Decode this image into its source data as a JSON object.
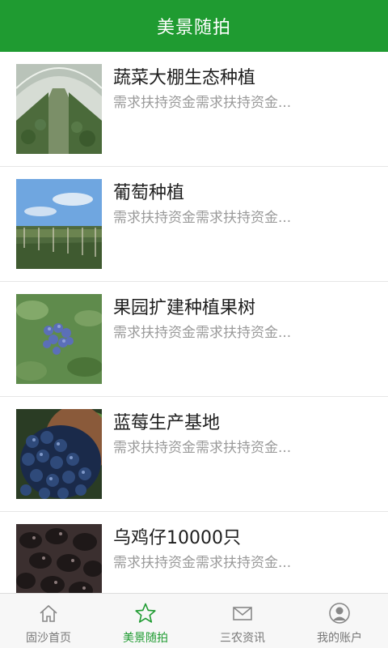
{
  "header": {
    "title": "美景随拍"
  },
  "colors": {
    "accent": "#1f9b31",
    "text": "#1e1e1e",
    "muted": "#9a9a9a"
  },
  "items": [
    {
      "title": "蔬菜大棚生态种植",
      "desc": "需求扶持资金需求扶持资金...",
      "image": "greenhouse-photo"
    },
    {
      "title": "葡萄种植",
      "desc": "需求扶持资金需求扶持资金...",
      "image": "vineyard-photo"
    },
    {
      "title": "果园扩建种植果树",
      "desc": "需求扶持资金需求扶持资金...",
      "image": "blueberry-bush-photo"
    },
    {
      "title": "蓝莓生产基地",
      "desc": "需求扶持资金需求扶持资金...",
      "image": "blueberry-bowl-photo"
    },
    {
      "title": "乌鸡仔10000只",
      "desc": "需求扶持资金需求扶持资金...",
      "image": "black-chickens-photo"
    }
  ],
  "tabs": [
    {
      "label": "固沙首页",
      "icon": "home-icon",
      "active": false
    },
    {
      "label": "美景随拍",
      "icon": "star-icon",
      "active": true
    },
    {
      "label": "三农资讯",
      "icon": "mail-icon",
      "active": false
    },
    {
      "label": "我的账户",
      "icon": "user-icon",
      "active": false
    }
  ]
}
